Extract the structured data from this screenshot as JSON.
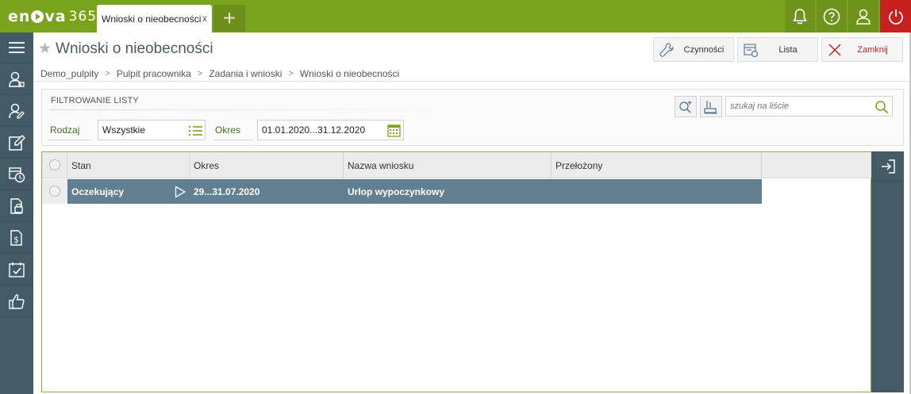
{
  "app": {
    "logo_text_left": "en",
    "logo_text_right": "va",
    "logo_number": "365"
  },
  "tabs": [
    {
      "label": "Wnioski o nieobecności",
      "close": "x"
    }
  ],
  "topbar_icons": [
    "bell-icon",
    "help-icon",
    "user-icon",
    "power-icon"
  ],
  "sidebar_icons": [
    "menu-icon",
    "employee-icon",
    "employee-edit-icon",
    "edit-icon",
    "calendar-clock-icon",
    "document-lock-icon",
    "document-money-icon",
    "calendar-check-icon",
    "thumbs-up-icon"
  ],
  "header": {
    "title": "Wnioski o nieobecności"
  },
  "actions": {
    "czynnosci": "Czynności",
    "lista": "Lista",
    "zamknij": "Zamknij"
  },
  "breadcrumb": [
    "Demo_pulpity",
    "Pulpit pracownika",
    "Zadania i wnioski",
    "Wnioski o nieobecności"
  ],
  "filter": {
    "title": "FILTROWANIE LISTY",
    "rodzaj_label": "Rodzaj",
    "rodzaj_value": "Wszystkie",
    "okres_label": "Okres",
    "okres_value": "01.01.2020...31.12.2020",
    "search_placeholder": "szukaj na liście"
  },
  "grid": {
    "columns": [
      "Stan",
      "Okres",
      "Nazwa wniosku",
      "Przełożony"
    ],
    "rows": [
      {
        "stan": "Oczekujący",
        "okres": "29...31.07.2020",
        "nazwa": "Urlop wypoczynkowy",
        "przelozony": ""
      }
    ]
  },
  "colors": {
    "brand_green": "#7aa31d",
    "sidebar": "#435a67",
    "row_selected": "#607f91",
    "close_red": "#c8201f"
  }
}
